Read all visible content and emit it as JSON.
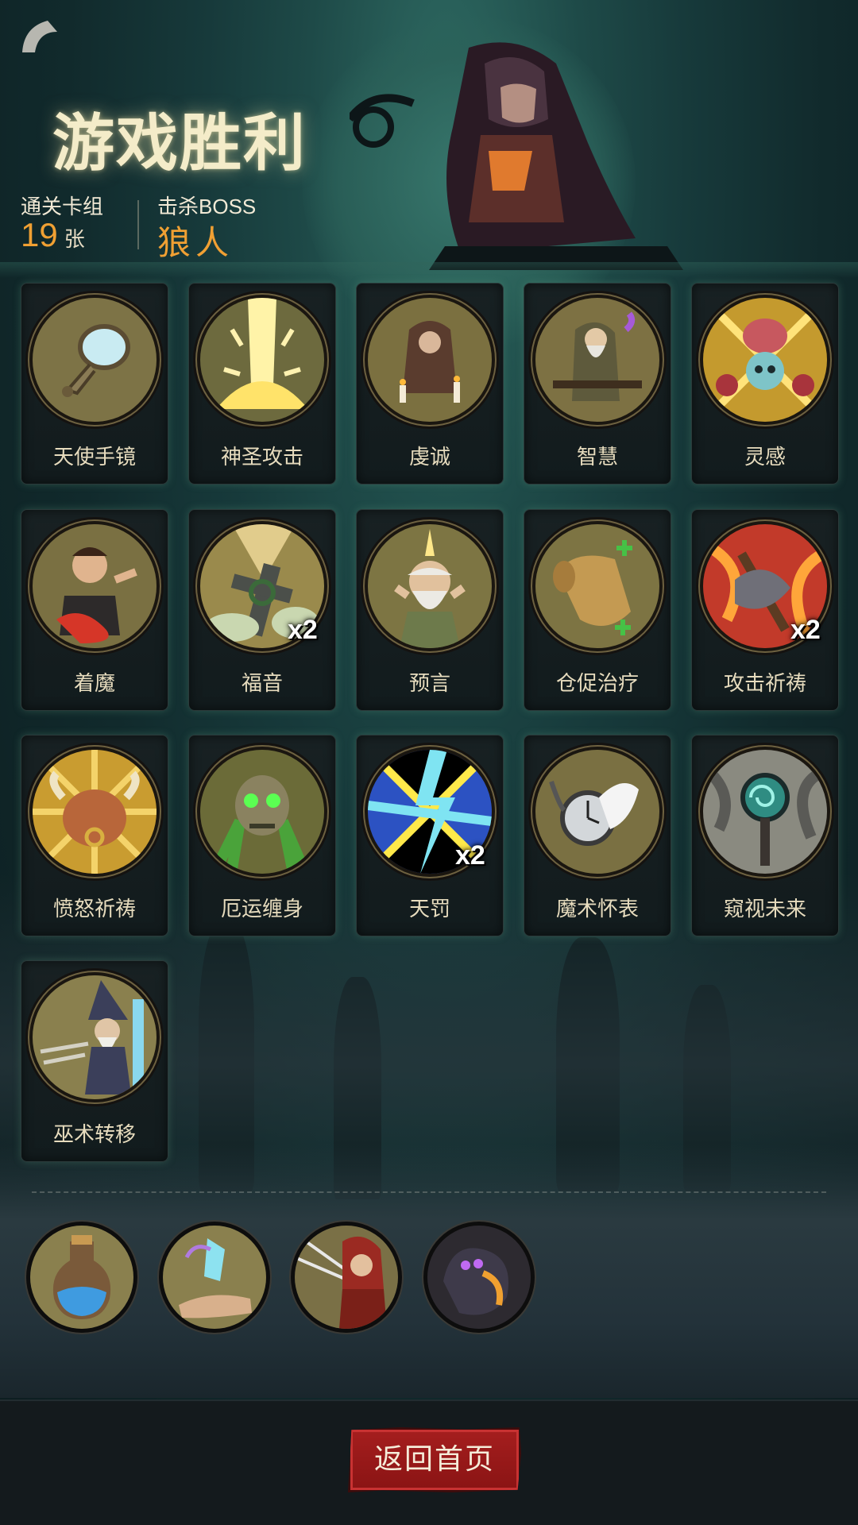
{
  "header": {
    "title": "游戏胜利",
    "deck_label": "通关卡组",
    "deck_count": "19",
    "deck_unit": "张",
    "boss_label": "击杀BOSS",
    "boss_name": "狼人"
  },
  "cards": [
    {
      "name": "天使手镜",
      "count": "",
      "icon": "mirror-icon"
    },
    {
      "name": "神圣攻击",
      "count": "",
      "icon": "holy-light-icon"
    },
    {
      "name": "虔诚",
      "count": "",
      "icon": "praying-monk-icon"
    },
    {
      "name": "智慧",
      "count": "",
      "icon": "sage-icon"
    },
    {
      "name": "灵感",
      "count": "",
      "icon": "brain-skull-icon"
    },
    {
      "name": "着魔",
      "count": "",
      "icon": "possessed-man-icon"
    },
    {
      "name": "福音",
      "count": "x2",
      "icon": "grave-cross-icon"
    },
    {
      "name": "预言",
      "count": "",
      "icon": "prophet-icon"
    },
    {
      "name": "仓促治疗",
      "count": "",
      "icon": "scroll-icon"
    },
    {
      "name": "攻击祈祷",
      "count": "x2",
      "icon": "flaming-axe-icon"
    },
    {
      "name": "愤怒祈祷",
      "count": "",
      "icon": "minotaur-icon"
    },
    {
      "name": "厄运缠身",
      "count": "",
      "icon": "green-skull-icon"
    },
    {
      "name": "天罚",
      "count": "x2",
      "icon": "lightning-icon"
    },
    {
      "name": "魔术怀表",
      "count": "",
      "icon": "pocket-watch-icon"
    },
    {
      "name": "窥视未来",
      "count": "",
      "icon": "spiral-staff-icon"
    },
    {
      "name": "巫术转移",
      "count": "",
      "icon": "wizard-icon"
    }
  ],
  "relics": [
    {
      "icon": "potion-bottle-icon"
    },
    {
      "icon": "crystal-hand-icon"
    },
    {
      "icon": "red-hood-icon"
    },
    {
      "icon": "shadow-beast-icon"
    }
  ],
  "footer": {
    "home_button": "返回首页"
  },
  "colors": {
    "accent": "#f0a033",
    "button_red": "#a51e1e"
  }
}
